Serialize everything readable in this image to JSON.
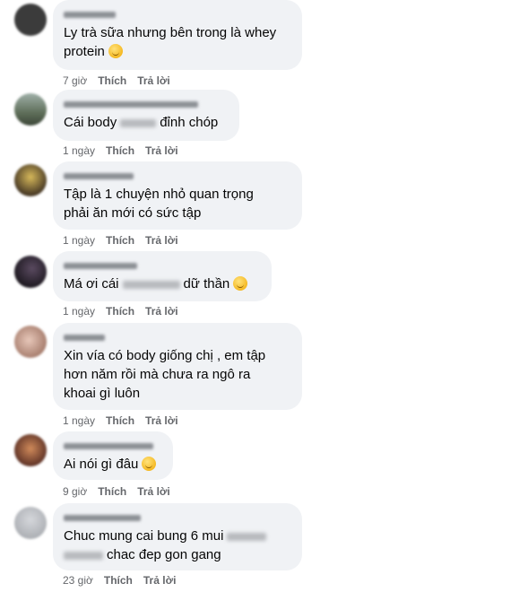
{
  "comments": [
    {
      "text": "Ly trà sữa nhưng bên trong là whey\nprotein",
      "time": "7 giờ",
      "like": "Thích",
      "reply": "Trả lời",
      "avatar_color": "#3a3a3a",
      "emoji": true
    },
    {
      "text_before": "Cái body",
      "text_after": "đỉnh chóp",
      "time": "1 ngày",
      "like": "Thích",
      "reply": "Trả lời",
      "avatar_color": "#6e7f6a"
    },
    {
      "text": "Tập là 1 chuyện nhỏ quan trọng\nphải ăn mới có sức tập",
      "time": "1 ngày",
      "like": "Thích",
      "reply": "Trả lời",
      "avatar_color": "#4a4030"
    },
    {
      "text_before": "Má ơi cái",
      "text_after": "dữ thần",
      "time": "1 ngày",
      "like": "Thích",
      "reply": "Trả lời",
      "avatar_color": "#2a2530",
      "emoji": true
    },
    {
      "text": "Xin vía có body giống chị , em tập\nhơn năm rồi mà chưa ra ngô ra\nkhoai gì luôn",
      "time": "1 ngày",
      "like": "Thích",
      "reply": "Trả lời",
      "avatar_color": "#c9a79a"
    },
    {
      "text": "Ai nói gì đâu",
      "time": "9 giờ",
      "like": "Thích",
      "reply": "Trả lời",
      "avatar_color": "#7a4a3a",
      "emoji": true
    },
    {
      "text_line1": "Chuc mung cai bung 6 mui",
      "text_line2": "chac đep gon gang",
      "time": "23 giờ",
      "like": "Thích",
      "reply": "Trả lời",
      "avatar_color": "#c4c6ca"
    }
  ]
}
